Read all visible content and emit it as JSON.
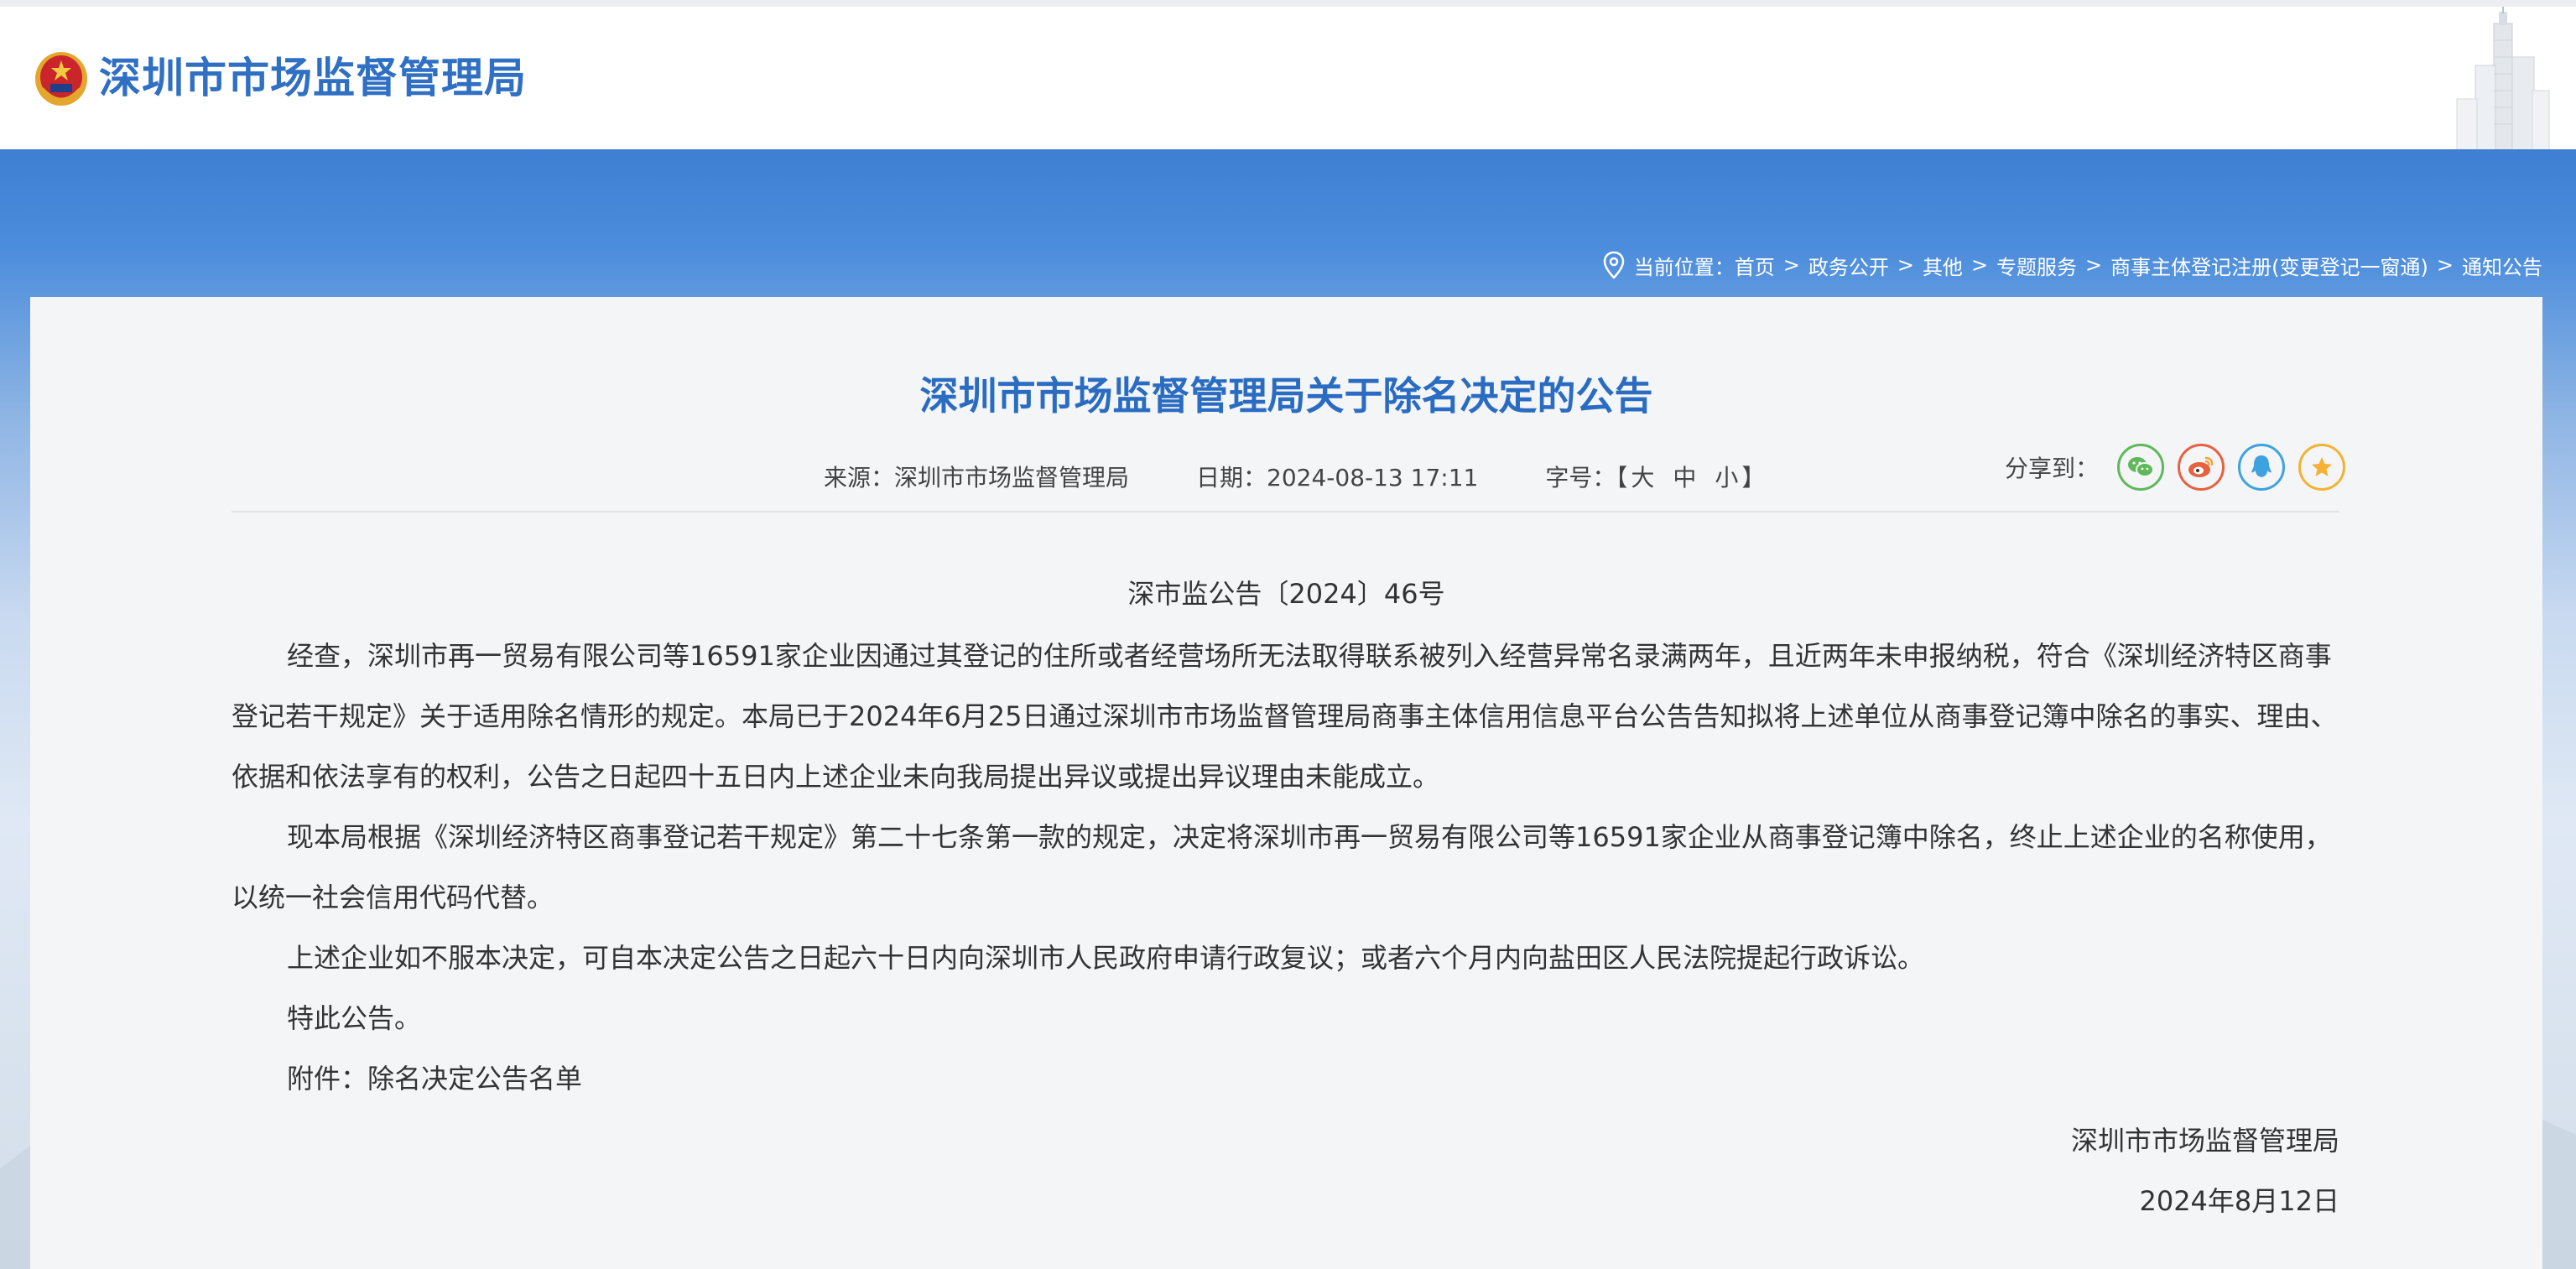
{
  "header": {
    "site_title": "深圳市市场监督管理局"
  },
  "breadcrumb": {
    "label": "当前位置：",
    "items": [
      "首页",
      "政务公开",
      "其他",
      "专题服务",
      "商事主体登记注册(变更登记一窗通)",
      "通知公告"
    ],
    "separator": ">"
  },
  "article": {
    "title": "深圳市市场监督管理局关于除名决定的公告",
    "meta": {
      "source": "来源：深圳市市场监督管理局",
      "date": "日期：2024-08-13 17:11",
      "font_size_label": "字号：【",
      "font_large": "大",
      "font_medium": "中",
      "font_small": "小",
      "font_close": "】"
    },
    "share": {
      "label": "分享到：",
      "icons": [
        "wechat-icon",
        "weibo-icon",
        "qq-icon",
        "favorite-star-icon"
      ],
      "colors": [
        "#5fb85a",
        "#e8613f",
        "#3fa2e0",
        "#f3b233"
      ]
    },
    "doc_number": "深市监公告〔2024〕46号",
    "paragraph1": {
      "line1": "经查，深圳市再一贸易有限公司等16591家企业因通过其登记的住所或者经营场所无法取得联系被列入经营异常名录满两年，且近两年未申报纳税，符合《深圳经济特区商事",
      "line2": "登记若干规定》关于适用除名情形的规定。本局已于2024年6月25日通过深圳市市场监督管理局商事主体信用信息平台公告告知拟将上述单位从商事登记簿中除名的事实、理由、",
      "line3": "依据和依法享有的权利，公告之日起四十五日内上述企业未向我局提出异议或提出异议理由未能成立。"
    },
    "paragraph2": {
      "line1": "现本局根据《深圳经济特区商事登记若干规定》第二十七条第一款的规定，决定将深圳市再一贸易有限公司等16591家企业从商事登记簿中除名，终止上述企业的名称使用，",
      "line2": "以统一社会信用代码代替。"
    },
    "paragraph3": "上述企业如不服本决定，可自本决定公告之日起六十日内向深圳市人民政府申请行政复议；或者六个月内向盐田区人民法院提起行政诉讼。",
    "paragraph4": "特此公告。",
    "attachment_label": "附件：",
    "attachment_link": "除名决定公告名单",
    "signature": "深圳市市场监督管理局",
    "sign_date": "2024年8月12日"
  },
  "colors": {
    "brand_blue": "#2f6fc4",
    "title_blue": "#2a6cc2",
    "banner_blue": "#3f7fd3",
    "content_bg": "#f4f5f7"
  }
}
